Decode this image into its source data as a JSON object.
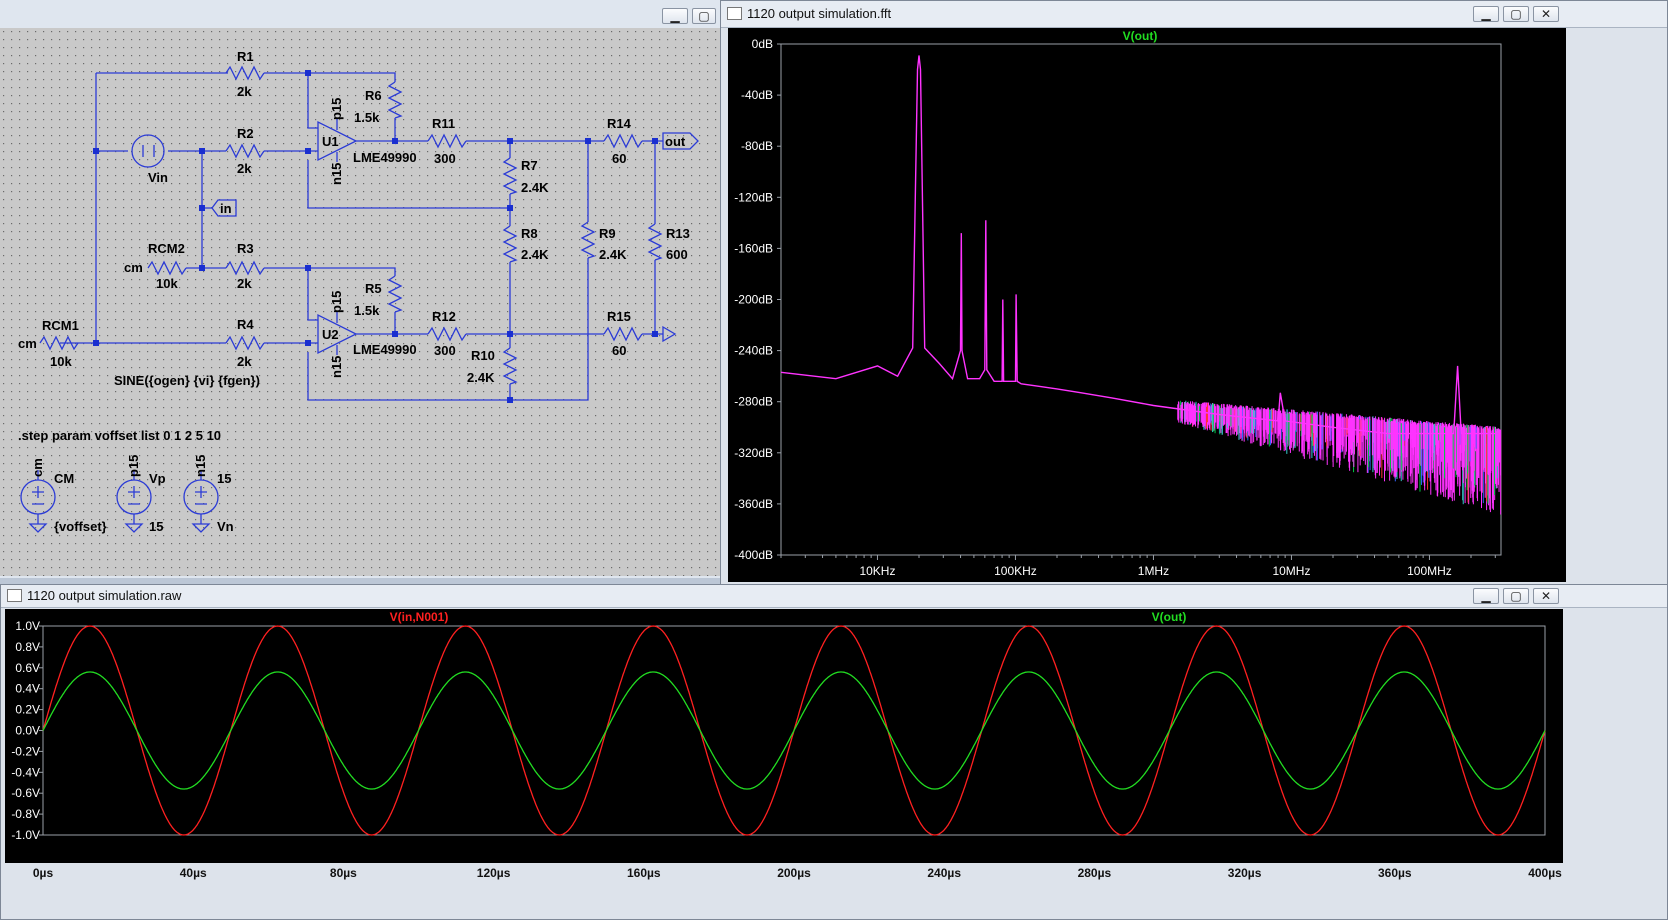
{
  "schematic": {
    "labels": {
      "r1": "R1",
      "r1v": "2k",
      "r2": "R2",
      "r2v": "2k",
      "r3": "R3",
      "r3v": "2k",
      "r4": "R4",
      "r4v": "2k",
      "r5": "R5",
      "r5v": "1.5k",
      "r6": "R6",
      "r6v": "1.5k",
      "r7": "R7",
      "r7v": "2.4K",
      "r8": "R8",
      "r8v": "2.4K",
      "r9": "R9",
      "r9v": "2.4K",
      "r10": "R10",
      "r10v": "2.4K",
      "r11": "R11",
      "r11v": "300",
      "r12": "R12",
      "r12v": "300",
      "r13": "R13",
      "r13v": "600",
      "r14": "R14",
      "r14v": "60",
      "r15": "R15",
      "r15v": "60",
      "rcm1": "RCM1",
      "rcm1v": "10k",
      "rcm2": "RCM2",
      "rcm2v": "10k",
      "u1": "U1",
      "u2": "U2",
      "u1part": "LME49990",
      "u2part": "LME49990",
      "p15a": "p15",
      "n15a": "n15",
      "p15b": "p15",
      "n15b": "n15",
      "vin": "Vin",
      "sine": "SINE({ogen} {vi} {fgen})",
      "net_in": "in",
      "net_out": "out",
      "cm1": "cm",
      "cm2": "cm",
      "step": ".step param voffset list 0 1 2 5 10",
      "src_cm_net": "cm",
      "src_cm_name": "CM",
      "src_cm_val": "{voffset}",
      "src_vp_net": "p15",
      "src_vp_name": "Vp",
      "src_vp_val": "15",
      "src_vn_net": "n15",
      "src_vn_name": "Vn",
      "src_vn_val": "15"
    }
  },
  "fft_window": {
    "title": "1120 output simulation.fft",
    "trace_label": "V(out)",
    "y_ticks": [
      "0dB",
      "-40dB",
      "-80dB",
      "-120dB",
      "-160dB",
      "-200dB",
      "-240dB",
      "-280dB",
      "-320dB",
      "-360dB",
      "-400dB"
    ],
    "x_ticks": [
      "10KHz",
      "100KHz",
      "1MHz",
      "10MHz",
      "100MHz"
    ]
  },
  "raw_window": {
    "title": "1120 output simulation.raw",
    "trace1_label": "V(in,N001)",
    "trace2_label": "V(out)",
    "y_ticks": [
      "1.0V",
      "0.8V",
      "0.6V",
      "0.4V",
      "0.2V",
      "0.0V",
      "-0.2V",
      "-0.4V",
      "-0.6V",
      "-0.8V",
      "-1.0V"
    ],
    "x_ticks": [
      "0µs",
      "40µs",
      "80µs",
      "120µs",
      "160µs",
      "200µs",
      "240µs",
      "280µs",
      "320µs",
      "360µs",
      "400µs"
    ]
  },
  "chart_data": [
    {
      "type": "line",
      "title": "V(out)",
      "x_scale": "log",
      "xlabel": "",
      "ylabel": "",
      "ylim": [
        -400,
        0
      ],
      "y_unit": "dB",
      "series": [
        {
          "name": "V(out)",
          "color": "#ff33ff",
          "x": [
            2000,
            5000,
            10000,
            14000,
            18000,
            19500,
            20000,
            20500,
            22000,
            28000,
            35000,
            40000,
            40500,
            41000,
            45000,
            55000,
            60000,
            61000,
            62000,
            70000,
            80000,
            81000,
            82000,
            90000,
            100000,
            101000,
            103000,
            110000,
            150000,
            200000,
            300000,
            500000,
            1000000,
            3000000,
            8000000,
            8300000,
            9000000,
            20000000,
            50000000,
            150000000,
            160000000,
            170000000,
            300000000
          ],
          "y": [
            -257,
            -262,
            -252,
            -260,
            -238,
            -20,
            -9,
            -20,
            -238,
            -250,
            -262,
            -240,
            -148,
            -240,
            -262,
            -262,
            -255,
            -138,
            -255,
            -264,
            -264,
            -200,
            -264,
            -264,
            -264,
            -196,
            -264,
            -266,
            -268,
            -270,
            -273,
            -277,
            -283,
            -290,
            -295,
            -273,
            -295,
            -300,
            -305,
            -305,
            -252,
            -305,
            -305
          ]
        }
      ],
      "colors": {
        "dominant": "#ff33ff",
        "under_traces": [
          "#00cc44",
          "#3366ff",
          "#ff3333",
          "#33cccc"
        ]
      }
    },
    {
      "type": "line",
      "xlabel": "",
      "ylabel": "",
      "xlim": [
        0,
        400
      ],
      "x_unit": "µs",
      "ylim": [
        -1,
        1
      ],
      "y_unit": "V",
      "series": [
        {
          "name": "V(in,N001)",
          "color": "#ff2020",
          "amplitude": 1.0,
          "frequency_khz": 20,
          "phase": "sine"
        },
        {
          "name": "V(out)",
          "color": "#22dd22",
          "amplitude": 0.56,
          "frequency_khz": 20,
          "phase": "sine"
        }
      ]
    }
  ],
  "colors": {
    "wire": "#2b3bd6",
    "junction": "#1a2fd0",
    "grid_bg": "#c8c8c8",
    "plot_bg": "#000000",
    "frame": "#9aa0a8"
  }
}
